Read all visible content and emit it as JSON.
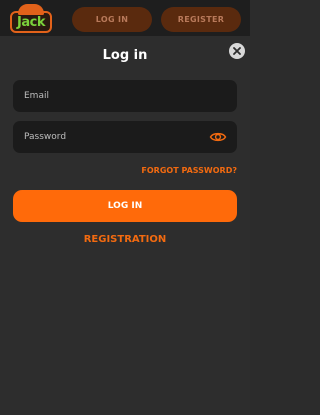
{
  "header": {
    "logo_text": "Jack",
    "login_label": "LOG IN",
    "register_label": "REGISTER"
  },
  "modal": {
    "title": "Log in",
    "email": {
      "placeholder": "Email",
      "value": ""
    },
    "password": {
      "placeholder": "Password",
      "value": ""
    },
    "forgot_label": "FORGOT PASSWORD?",
    "login_label": "LOG IN",
    "registration_label": "REGISTRATION"
  },
  "icons": {
    "close": "close-icon",
    "eye": "eye-icon"
  },
  "colors": {
    "accent": "#ff6a0a",
    "link": "#f26a10",
    "background": "#2d2d2d",
    "field": "#1b1b1b",
    "header_button": "#5a2a0e"
  }
}
